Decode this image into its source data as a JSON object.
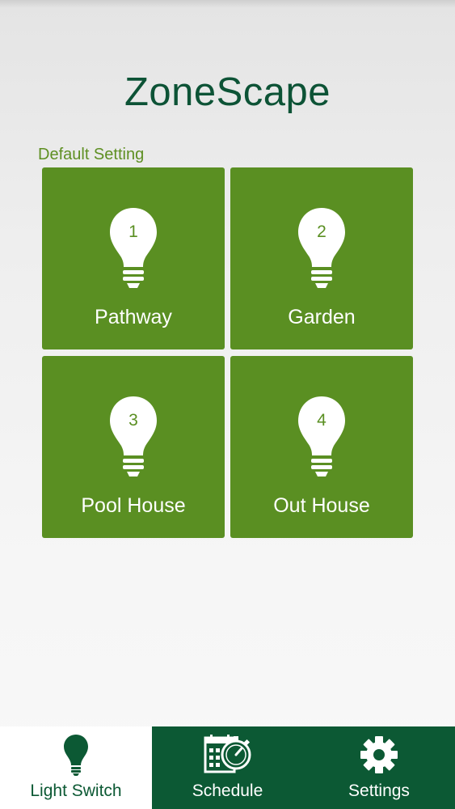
{
  "app": {
    "title": "ZoneScape"
  },
  "section": {
    "label": "Default Setting"
  },
  "zones": [
    {
      "number": "1",
      "name": "Pathway"
    },
    {
      "number": "2",
      "name": "Garden"
    },
    {
      "number": "3",
      "name": "Pool House"
    },
    {
      "number": "4",
      "name": "Out House"
    }
  ],
  "nav": [
    {
      "label": "Light Switch",
      "icon": "lightbulb-icon",
      "active": true
    },
    {
      "label": "Schedule",
      "icon": "calendar-stopwatch-icon",
      "active": false
    },
    {
      "label": "Settings",
      "icon": "gear-icon",
      "active": false
    }
  ],
  "colors": {
    "tile": "#5a8f22",
    "nav_bar": "#0c5934",
    "title": "#0d5336",
    "section_label": "#5e8f22"
  }
}
